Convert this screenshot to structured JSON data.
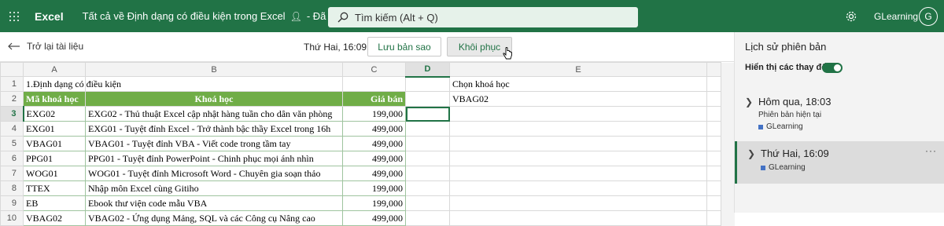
{
  "header": {
    "app_name": "Excel",
    "doc_title": "Tất cả về Định dạng có điều kiện trong Excel",
    "save_status": "- Đã lưu",
    "search_placeholder": "Tìm kiếm (Alt + Q)",
    "user_name": "GLearning",
    "avatar_initial": "G",
    "brand_color": "#217346"
  },
  "toolbar": {
    "back_label": "Trở lại tài liệu",
    "timestamp": "Thứ Hai, 16:09",
    "save_copy_label": "Lưu bản sao",
    "restore_label": "Khôi phục"
  },
  "grid": {
    "columns": [
      "A",
      "B",
      "C",
      "D",
      "E"
    ],
    "selected_column": "D",
    "selected_row": "3",
    "rows": [
      {
        "num": "1",
        "a": "1.Định dạng có điều kiện",
        "b": "",
        "c": "",
        "d": "",
        "e": "Chọn khoá học"
      },
      {
        "num": "2",
        "a": "Mã khoá học",
        "b": "Khoá học",
        "c": "Giá bán",
        "d": "",
        "e": "VBAG02"
      },
      {
        "num": "3",
        "a": "EXG02",
        "b": "EXG02 - Thủ thuật Excel cập nhật hàng tuần cho dân văn phòng",
        "c": "199,000",
        "d": "",
        "e": ""
      },
      {
        "num": "4",
        "a": "EXG01",
        "b": "EXG01 - Tuyệt đỉnh Excel - Trở thành bậc thầy Excel trong 16h",
        "c": "499,000",
        "d": "",
        "e": ""
      },
      {
        "num": "5",
        "a": "VBAG01",
        "b": "VBAG01 - Tuyệt đỉnh VBA - Viết code trong tầm tay",
        "c": "499,000",
        "d": "",
        "e": ""
      },
      {
        "num": "6",
        "a": "PPG01",
        "b": "PPG01 - Tuyệt đỉnh PowerPoint - Chinh phục mọi ánh nhìn",
        "c": "499,000",
        "d": "",
        "e": ""
      },
      {
        "num": "7",
        "a": "WOG01",
        "b": "WOG01 - Tuyệt đỉnh Microsoft Word - Chuyên gia soạn thảo",
        "c": "499,000",
        "d": "",
        "e": ""
      },
      {
        "num": "8",
        "a": "TTEX",
        "b": "Nhập môn Excel cùng Gitiho",
        "c": "199,000",
        "d": "",
        "e": ""
      },
      {
        "num": "9",
        "a": "EB",
        "b": "Ebook thư viện code mẫu VBA",
        "c": "199,000",
        "d": "",
        "e": ""
      },
      {
        "num": "10",
        "a": "VBAG02",
        "b": "VBAG02 - Ứng dụng Mảng, SQL và các Công cụ Nâng cao",
        "c": "499,000",
        "d": "",
        "e": ""
      }
    ],
    "header_fill": "#70ad47"
  },
  "panel": {
    "title": "Lịch sử phiên bản",
    "toggle_label": "Hiển thị các thay đổi",
    "toggle_on": true,
    "versions": [
      {
        "date": "Hôm qua, 18:03",
        "subtitle": "Phiên bản hiện tại",
        "user": "GLearning"
      },
      {
        "date": "Thứ Hai, 16:09",
        "subtitle": "",
        "user": "GLearning"
      }
    ],
    "more_label": "···"
  }
}
